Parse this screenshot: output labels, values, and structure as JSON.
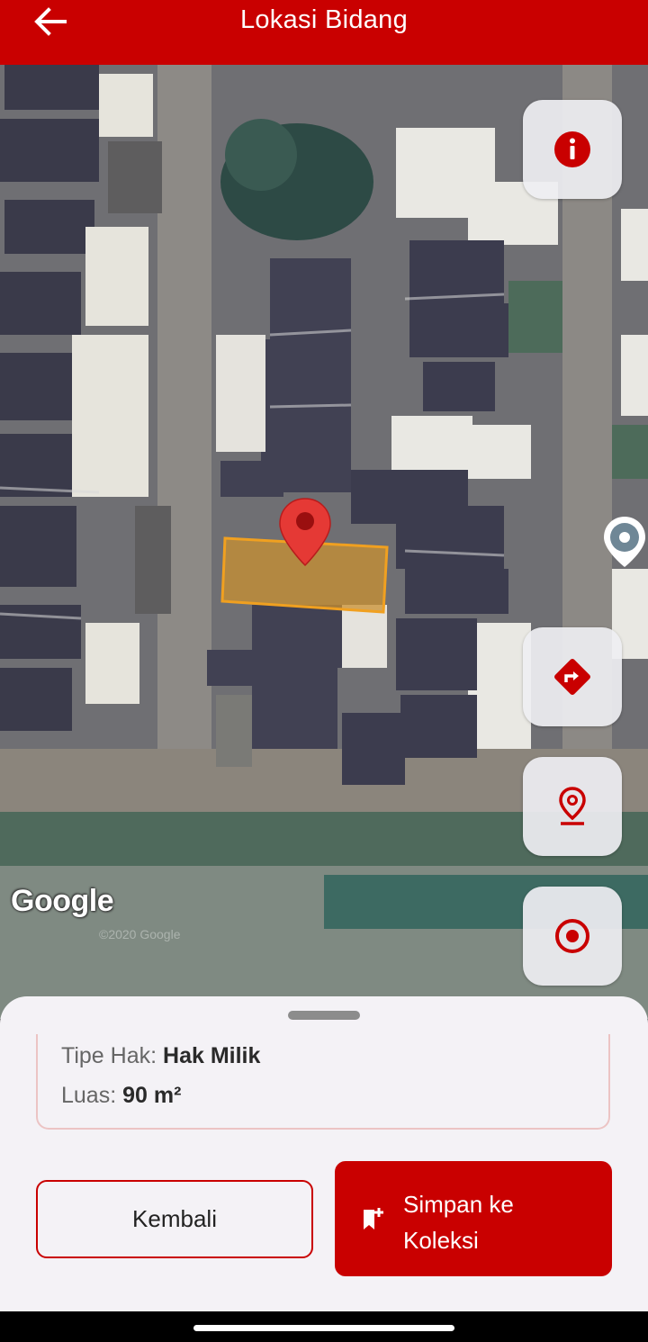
{
  "appbar": {
    "title": "Lokasi Bidang"
  },
  "map": {
    "logo": "Google",
    "copyright": "©2020 Google",
    "type": "satellite",
    "parcel_color": "#f0a020",
    "pin_color": "#e53935"
  },
  "fabs": [
    "info-icon",
    "directions-icon",
    "location-pin-icon",
    "my-location-icon"
  ],
  "sheet": {
    "tipe_hak_label": "Tipe Hak:",
    "tipe_hak_value": "Hak Milik",
    "luas_label": "Luas:",
    "luas_value": "90 m²",
    "back_label": "Kembali",
    "save_label_line1": "Simpan ke",
    "save_label_line2": "Koleksi"
  },
  "colors": {
    "accent": "#c90000",
    "sheet_bg": "#f4f2f6"
  }
}
